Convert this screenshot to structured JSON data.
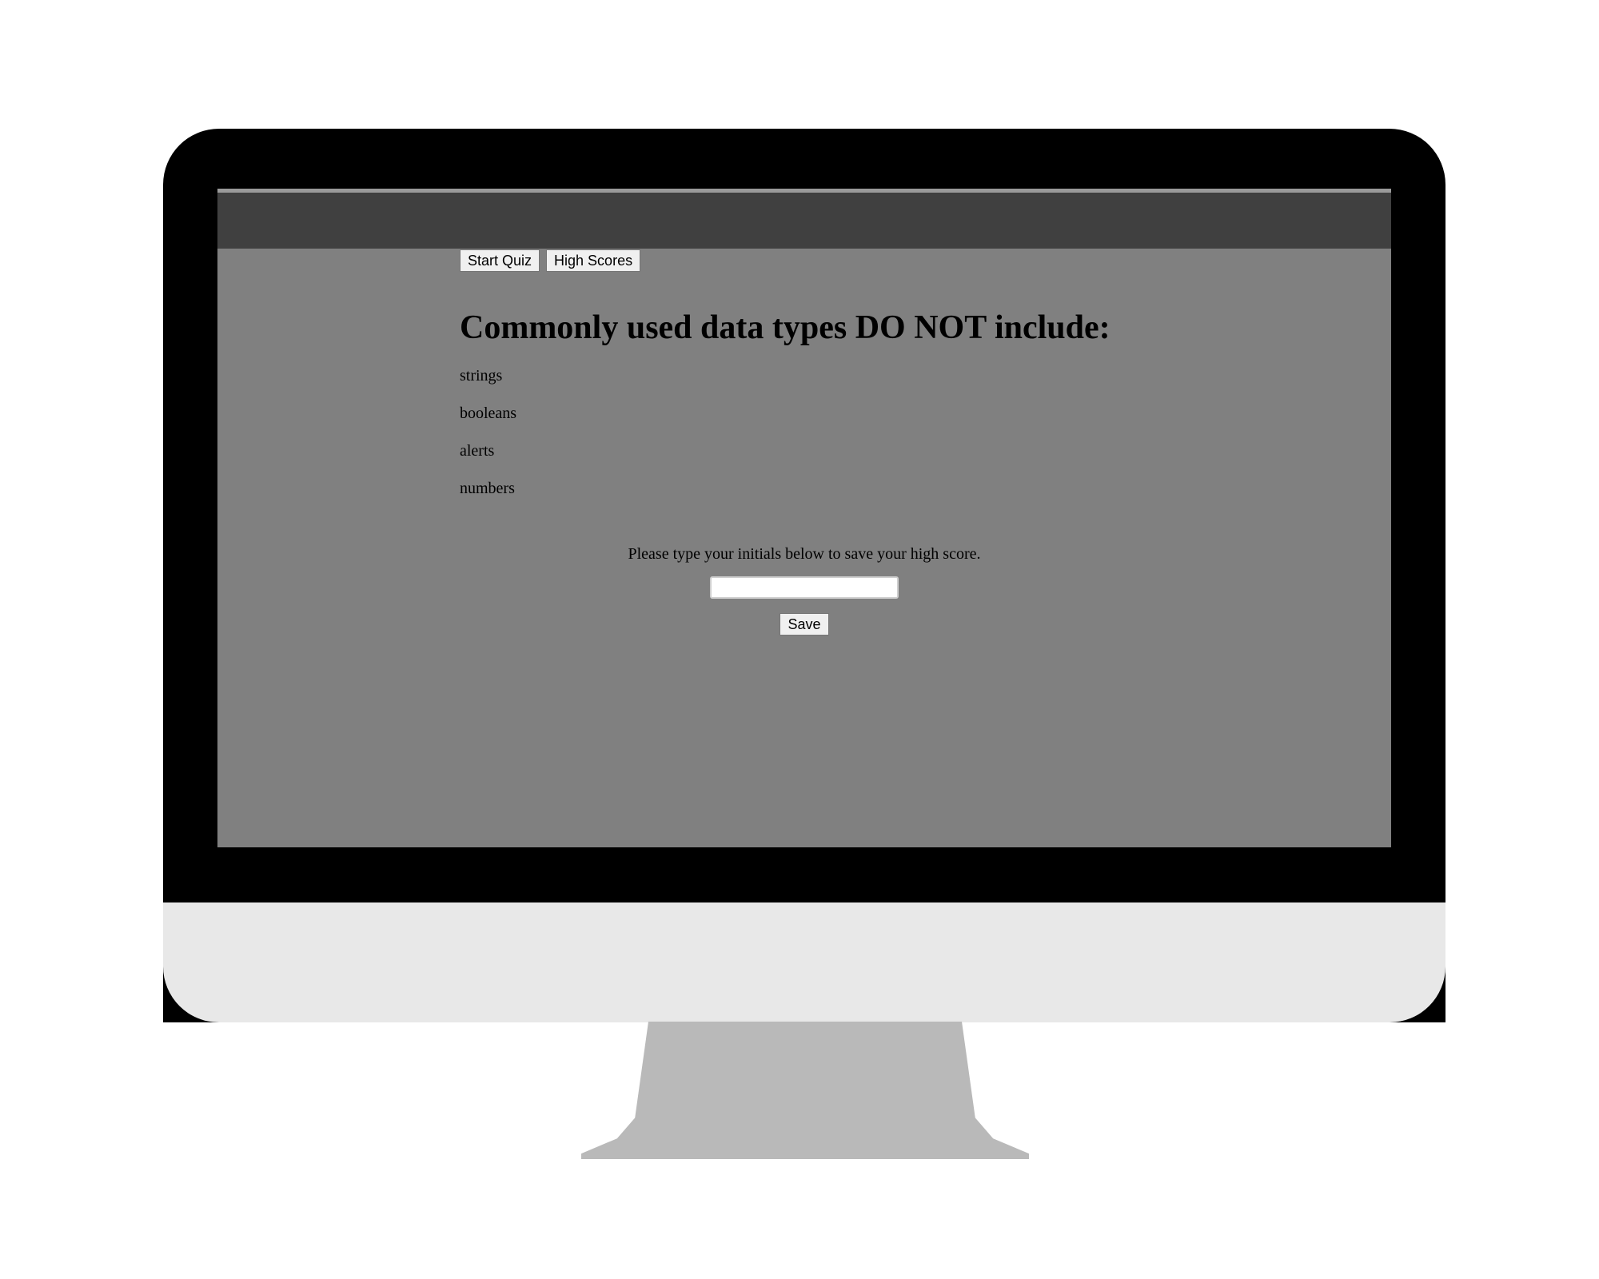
{
  "nav": {
    "start_quiz_label": "Start Quiz",
    "high_scores_label": "High Scores"
  },
  "quiz": {
    "question": "Commonly used data types DO NOT include:",
    "choices": [
      "strings",
      "booleans",
      "alerts",
      "numbers"
    ]
  },
  "save": {
    "prompt": "Please type your initials below to save your high score.",
    "initials_value": "",
    "save_label": "Save"
  },
  "colors": {
    "page_background": "#808080",
    "header_bar": "#404040",
    "bezel": "#000000",
    "chin": "#e8e8e8",
    "stand": "#b9b9b9"
  }
}
